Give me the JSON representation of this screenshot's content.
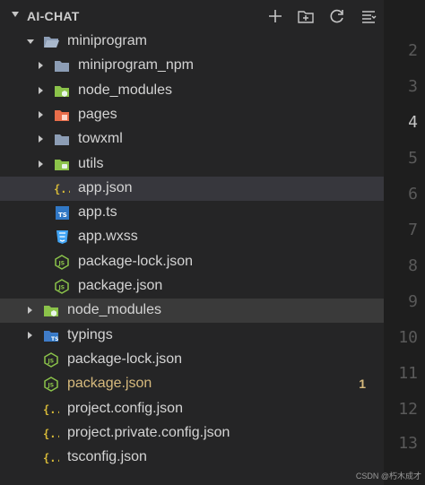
{
  "header": {
    "title": "AI-CHAT"
  },
  "tree": [
    {
      "label": "miniprogram",
      "indent": 1,
      "kind": "folder-open",
      "chev": "down"
    },
    {
      "label": "miniprogram_npm",
      "indent": 2,
      "kind": "folder",
      "chev": "right"
    },
    {
      "label": "node_modules",
      "indent": 2,
      "kind": "folder-node",
      "chev": "right"
    },
    {
      "label": "pages",
      "indent": 2,
      "kind": "folder-pages",
      "chev": "right"
    },
    {
      "label": "towxml",
      "indent": 2,
      "kind": "folder",
      "chev": "right"
    },
    {
      "label": "utils",
      "indent": 2,
      "kind": "folder-utils",
      "chev": "right"
    },
    {
      "label": "app.json",
      "indent": 2,
      "kind": "json",
      "selected": true
    },
    {
      "label": "app.ts",
      "indent": 2,
      "kind": "ts"
    },
    {
      "label": "app.wxss",
      "indent": 2,
      "kind": "css"
    },
    {
      "label": "package-lock.json",
      "indent": 2,
      "kind": "node"
    },
    {
      "label": "package.json",
      "indent": 2,
      "kind": "node"
    },
    {
      "label": "node_modules",
      "indent": 1,
      "kind": "folder-node",
      "chev": "right",
      "selected2": true
    },
    {
      "label": "typings",
      "indent": 1,
      "kind": "folder-ts",
      "chev": "right"
    },
    {
      "label": "package-lock.json",
      "indent": 1,
      "kind": "node"
    },
    {
      "label": "package.json",
      "indent": 1,
      "kind": "node",
      "modified": true,
      "badge": "1"
    },
    {
      "label": "project.config.json",
      "indent": 1,
      "kind": "json"
    },
    {
      "label": "project.private.config.json",
      "indent": 1,
      "kind": "json"
    },
    {
      "label": "tsconfig.json",
      "indent": 1,
      "kind": "json"
    }
  ],
  "line_numbers": [
    {
      "n": "2",
      "active": false
    },
    {
      "n": "3",
      "active": false
    },
    {
      "n": "4",
      "active": true
    },
    {
      "n": "5",
      "active": false
    },
    {
      "n": "6",
      "active": false
    },
    {
      "n": "7",
      "active": false
    },
    {
      "n": "8",
      "active": false
    },
    {
      "n": "9",
      "active": false
    },
    {
      "n": "10",
      "active": false
    },
    {
      "n": "11",
      "active": false
    },
    {
      "n": "12",
      "active": false
    },
    {
      "n": "13",
      "active": false
    }
  ],
  "watermark": "CSDN @朽木成才",
  "colors": {
    "folder": "#8c9db5",
    "node": "#8bc34a",
    "json": "#d7ba38",
    "ts": "#3178c6",
    "css": "#42a5f5",
    "pages": "#e86d4a",
    "modified": "#d7ba7d"
  }
}
